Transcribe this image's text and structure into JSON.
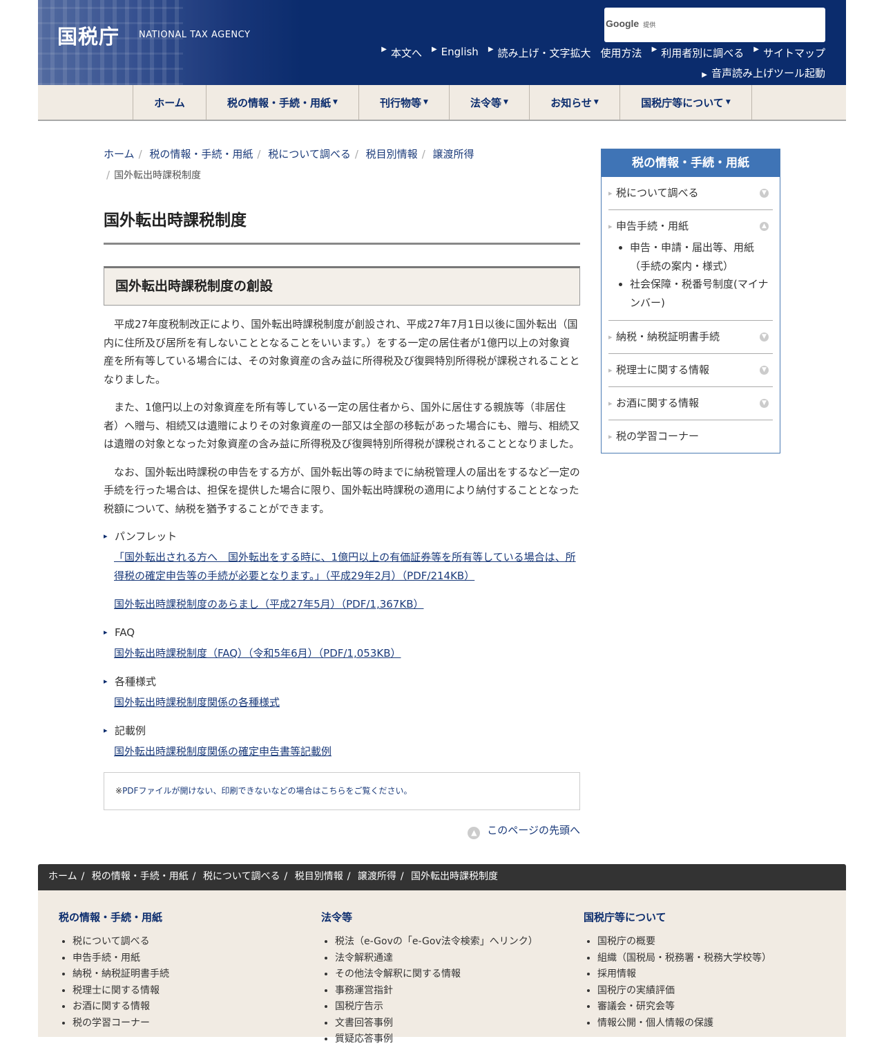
{
  "header": {
    "logo_ja": "国税庁",
    "logo_en": "NATIONAL TAX AGENCY",
    "search_brand": "Google",
    "search_provided": "提供",
    "util_links": [
      "本文へ",
      "English",
      "読み上げ・文字拡大",
      "使用方法",
      "利用者別に調べる",
      "サイトマップ"
    ],
    "util_voice": "音声読み上げツール起動"
  },
  "nav": {
    "items": [
      "ホーム",
      "税の情報・手続・用紙",
      "刊行物等",
      "法令等",
      "お知らせ",
      "国税庁等について"
    ]
  },
  "breadcrumb": {
    "items": [
      "ホーム",
      "税の情報・手続・用紙",
      "税について調べる",
      "税目別情報",
      "譲渡所得"
    ],
    "current": "国外転出時課税制度"
  },
  "main": {
    "title": "国外転出時課税制度",
    "section_title": "国外転出時課税制度の創設",
    "paragraphs": [
      "平成27年度税制改正により、国外転出時課税制度が創設され、平成27年7月1日以後に国外転出（国内に住所及び居所を有しないこととなることをいいます。）をする一定の居住者が1億円以上の対象資産を所有等している場合には、その対象資産の含み益に所得税及び復興特別所得税が課税されることとなりました。",
      "また、1億円以上の対象資産を所有等している一定の居住者から、国外に居住する親族等（非居住者）へ贈与、相続又は遺贈によりその対象資産の一部又は全部の移転があった場合にも、贈与、相続又は遺贈の対象となった対象資産の含み益に所得税及び復興特別所得税が課税されることとなりました。",
      "なお、国外転出時課税の申告をする方が、国外転出等の時までに納税管理人の届出をするなど一定の手続を行った場合は、担保を提供した場合に限り、国外転出時課税の適用により納付することとなった税額について、納税を猶予することができます。"
    ],
    "pamphlet": {
      "label": "パンフレット",
      "link1": "「国外転出される方へ　国外転出をする時に、1億円以上の有価証券等を所有等している場合は、所得税の確定申告等の手続が必要となります。」（平成29年2月）（PDF/214KB）",
      "link2": "国外転出時課税制度のあらまし（平成27年5月）（PDF/1,367KB）"
    },
    "faq": {
      "label": "FAQ",
      "link": "国外転出時課税制度（FAQ）（令和5年6月）（PDF/1,053KB）"
    },
    "forms": {
      "label": "各種様式",
      "link": "国外転出時課税制度関係の各種様式"
    },
    "examples": {
      "label": "記載例",
      "link": "国外転出時課税制度関係の確定申告書等記載例"
    },
    "pdf_note_prefix": "※",
    "pdf_note_link": "PDFファイルが開けない、印刷できないなどの場合はこちらをご覧ください。",
    "to_top": "このページの先頭へ"
  },
  "side": {
    "title": "税の情報・手続・用紙",
    "items": [
      "税について調べる",
      "申告手続・用紙",
      "納税・納税証明書手続",
      "税理士に関する情報",
      "お酒に関する情報",
      "税の学習コーナー"
    ],
    "sub_items": [
      "申告・申請・届出等、用紙（手続の案内・様式）",
      "社会保障・税番号制度(マイナンバー)"
    ]
  },
  "footer": {
    "col1": {
      "title": "税の情報・手続・用紙",
      "items": [
        "税について調べる",
        "申告手続・用紙",
        "納税・納税証明書手続",
        "税理士に関する情報",
        "お酒に関する情報",
        "税の学習コーナー"
      ]
    },
    "col2": {
      "title": "法令等",
      "items": [
        "税法（e-Govの「e-Gov法令検索」へリンク）",
        "法令解釈通達",
        "その他法令解釈に関する情報",
        "事務運営指針",
        "国税庁告示",
        "文書回答事例",
        "質疑応答事例"
      ]
    },
    "col3": {
      "title": "国税庁等について",
      "items": [
        "国税庁の概要",
        "組織（国税局・税務署・税務大学校等）",
        "採用情報",
        "国税庁の実績評価",
        "審議会・研究会等",
        "情報公開・個人情報の保護"
      ]
    }
  }
}
